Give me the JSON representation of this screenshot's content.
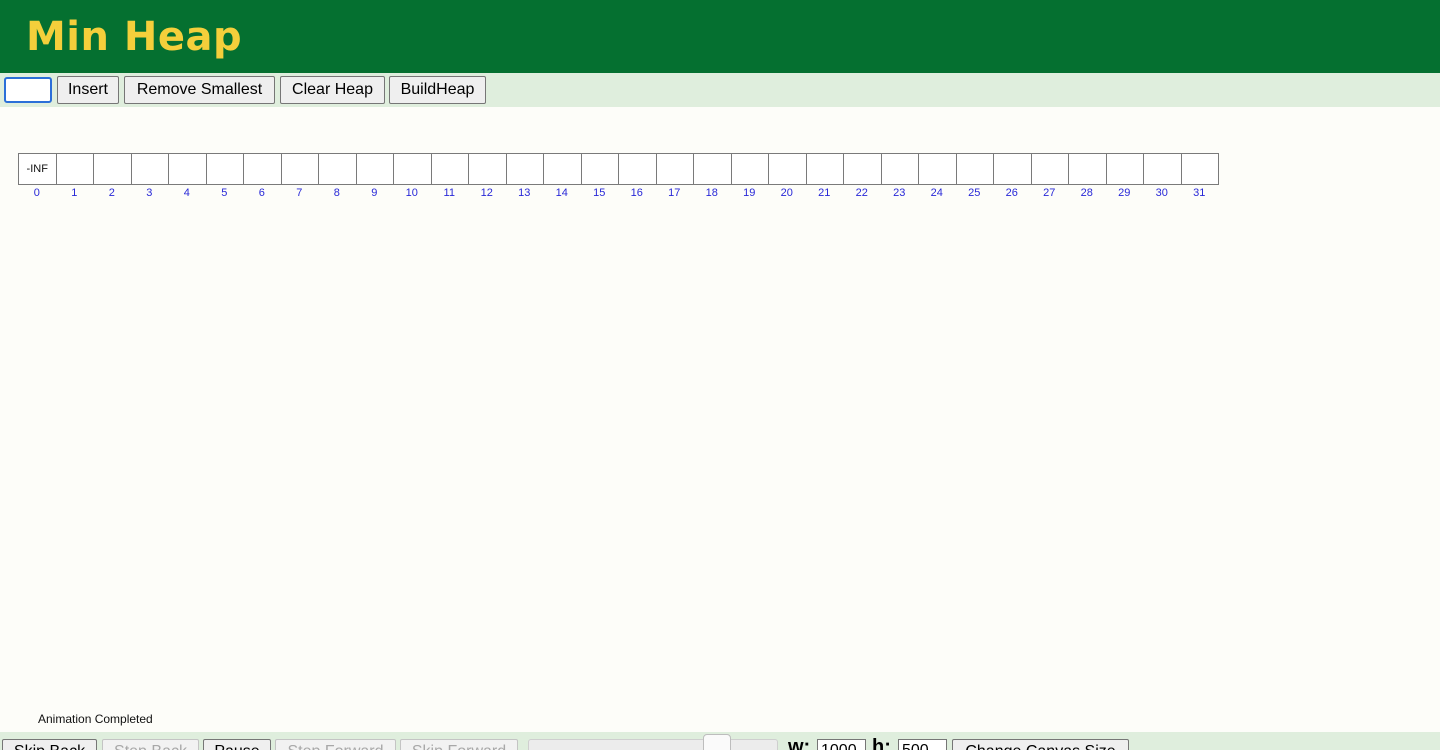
{
  "header": {
    "title": "Min Heap"
  },
  "controls": {
    "value_input": "",
    "insert_label": "Insert",
    "remove_smallest_label": "Remove Smallest",
    "clear_heap_label": "Clear Heap",
    "build_heap_label": "BuildHeap"
  },
  "heap": {
    "cells": [
      "-INF",
      "",
      "",
      "",
      "",
      "",
      "",
      "",
      "",
      "",
      "",
      "",
      "",
      "",
      "",
      "",
      "",
      "",
      "",
      "",
      "",
      "",
      "",
      "",
      "",
      "",
      "",
      "",
      "",
      "",
      "",
      ""
    ],
    "indices": [
      "0",
      "1",
      "2",
      "3",
      "4",
      "5",
      "6",
      "7",
      "8",
      "9",
      "10",
      "11",
      "12",
      "13",
      "14",
      "15",
      "16",
      "17",
      "18",
      "19",
      "20",
      "21",
      "22",
      "23",
      "24",
      "25",
      "26",
      "27",
      "28",
      "29",
      "30",
      "31"
    ]
  },
  "status": "Animation Completed",
  "animation_controls": {
    "skip_back_label": "Skip Back",
    "step_back_label": "Step Back",
    "pause_label": "Pause",
    "step_forward_label": "Step Forward",
    "skip_forward_label": "Skip Forward",
    "width_label": "w:",
    "width_value": "1000",
    "height_label": "h:",
    "height_value": "500",
    "change_canvas_label": "Change Canvas Size"
  },
  "colors": {
    "header_bg": "#057030",
    "title_color": "#f4cf3b",
    "toolbar_bg": "#dfeedd",
    "index_color": "#2828d8"
  }
}
